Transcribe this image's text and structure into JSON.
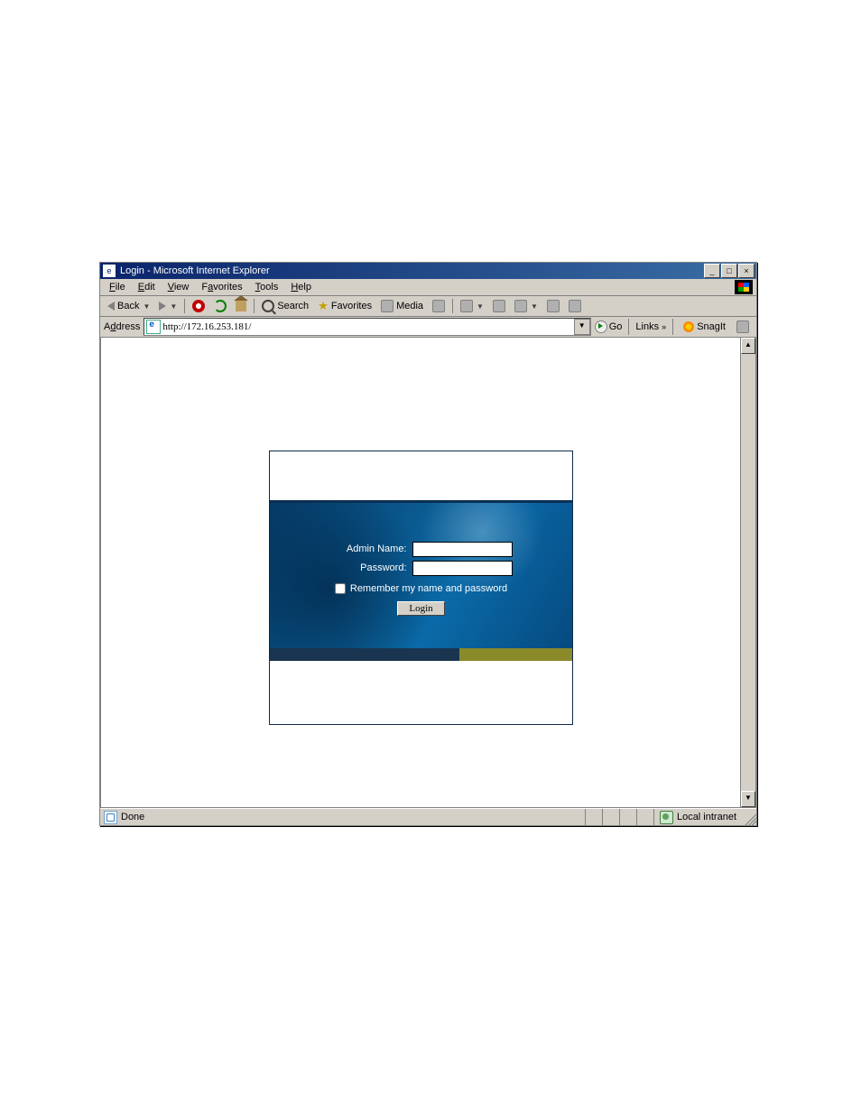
{
  "window": {
    "title": "Login - Microsoft Internet Explorer",
    "minimize": "_",
    "maximize": "□",
    "close": "×"
  },
  "menubar": {
    "items": [
      "File",
      "Edit",
      "View",
      "Favorites",
      "Tools",
      "Help"
    ]
  },
  "toolbar": {
    "back": "Back",
    "search": "Search",
    "favorites": "Favorites",
    "media": "Media"
  },
  "addressbar": {
    "label": "Address",
    "url": "http://172.16.253.181/",
    "go": "Go",
    "links": "Links",
    "snagit": "SnagIt"
  },
  "login": {
    "admin_label": "Admin Name:",
    "password_label": "Password:",
    "admin_value": "",
    "password_value": "",
    "remember_label": "Remember my name and password",
    "button": "Login"
  },
  "scrollbar": {
    "up": "▲",
    "down": "▼"
  },
  "statusbar": {
    "text": "Done",
    "zone": "Local intranet"
  }
}
